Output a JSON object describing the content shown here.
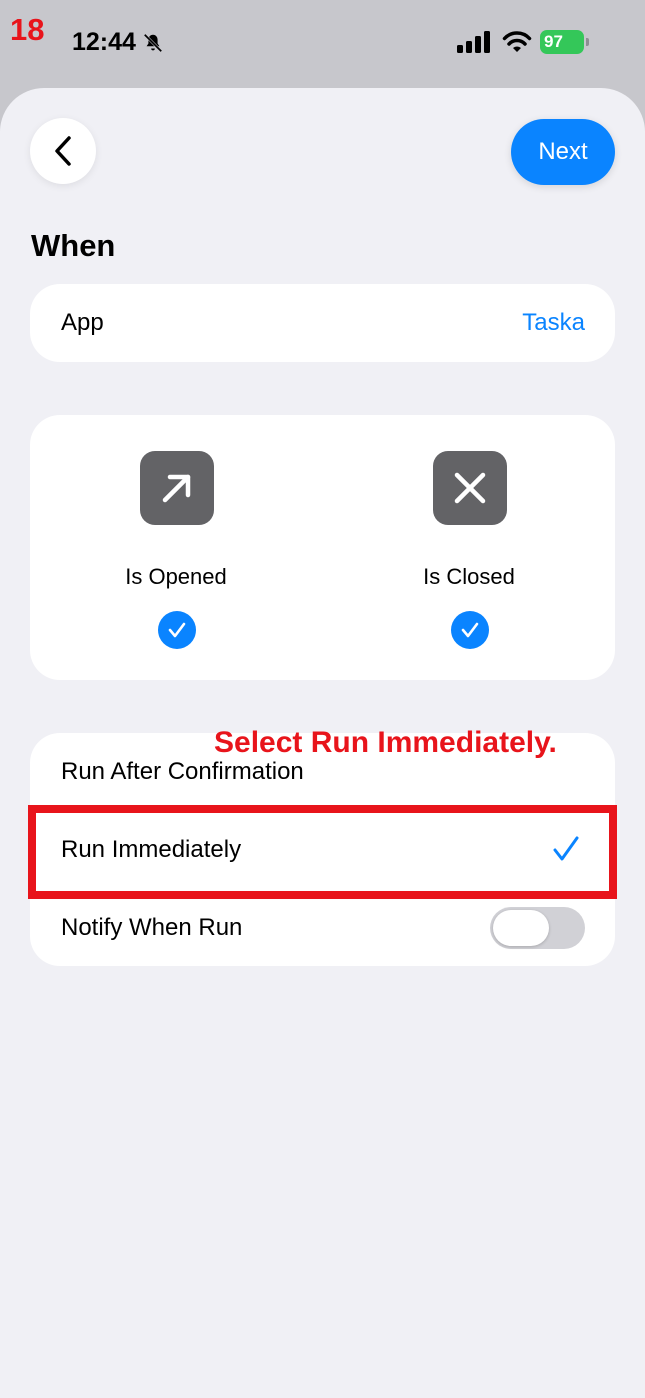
{
  "overlay": {
    "step_number": "18",
    "instruction": "Select Run Immediately."
  },
  "status_bar": {
    "time": "12:44",
    "battery": "97"
  },
  "header": {
    "next_label": "Next"
  },
  "when": {
    "title": "When",
    "app_label": "App",
    "app_value": "Taska"
  },
  "events": [
    {
      "label": "Is Opened",
      "icon": "arrow-up-right-icon",
      "checked": true
    },
    {
      "label": "Is Closed",
      "icon": "x-mark-icon",
      "checked": true
    }
  ],
  "run_options": {
    "items": [
      {
        "label": "Run After Confirmation",
        "selected": false
      },
      {
        "label": "Run Immediately",
        "selected": true
      }
    ],
    "notify_label": "Notify When Run",
    "notify_enabled": false
  },
  "colors": {
    "accent": "#0a84ff",
    "annotation": "#e8141b",
    "battery": "#34c759",
    "background": "#f0f0f5"
  }
}
